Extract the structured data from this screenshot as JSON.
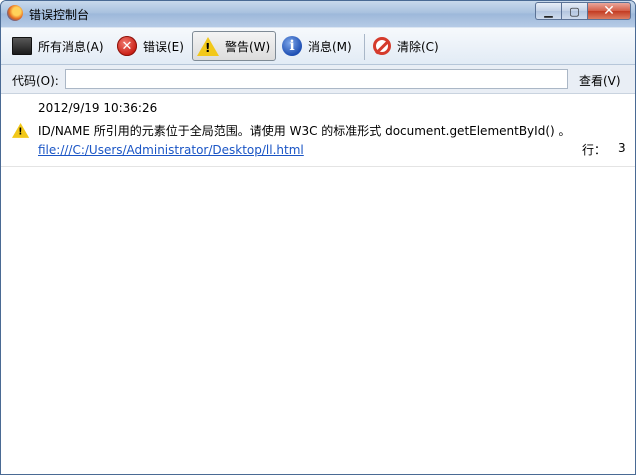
{
  "window": {
    "title": "错误控制台"
  },
  "toolbar": {
    "all": {
      "label": "所有消息(A)"
    },
    "errors": {
      "label": "错误(E)"
    },
    "warnings": {
      "label": "警告(W)"
    },
    "messages": {
      "label": "消息(M)"
    },
    "clear": {
      "label": "清除(C)"
    }
  },
  "codebar": {
    "label": "代码(O):",
    "value": "",
    "eval_label": "查看(V)"
  },
  "entries": [
    {
      "timestamp": "2012/9/19 10:36:26",
      "message": "ID/NAME 所引用的元素位于全局范围。请使用 W3C 的标准形式 document.getElementById() 。",
      "source": "file:///C:/Users/Administrator/Desktop/ll.html",
      "line_label": "行：",
      "line": "3",
      "icon": "warning-icon"
    }
  ],
  "colors": {
    "link": "#1a55c5",
    "titlebar": "#a9c1df",
    "close_button": "#c33b22",
    "warning": "#f2c81a"
  }
}
